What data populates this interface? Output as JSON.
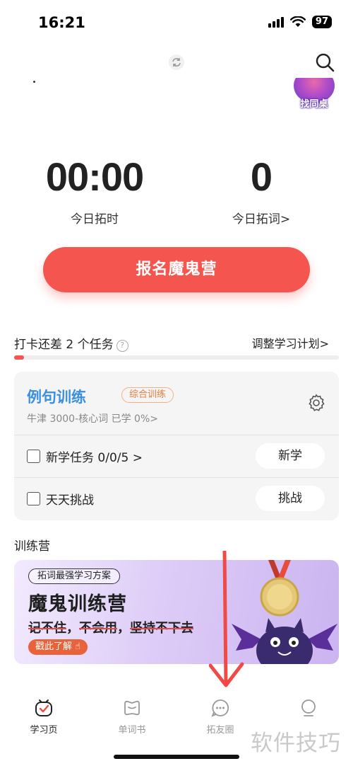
{
  "status_bar": {
    "time": "16:21",
    "battery": "97"
  },
  "header": {
    "find_desk_label": "找同桌"
  },
  "stats": [
    {
      "value": "00:00",
      "caption": "今日拓时"
    },
    {
      "value": "0",
      "caption": "今日拓词>"
    }
  ],
  "cta": {
    "label": "报名魔鬼营"
  },
  "checkin": {
    "text": "打卡还差 2 个任务",
    "help": "?",
    "adjust_link": "调整学习计划>",
    "progress_fraction": 0.03
  },
  "task_card": {
    "title": "例句训练",
    "tag": "综合训练",
    "subtitle": "牛津 3000-核心词  已学 0%>",
    "rows": [
      {
        "label": "新学任务 0/0/5 >",
        "button": "新学"
      },
      {
        "label": "天天挑战",
        "button": "挑战"
      }
    ]
  },
  "camp": {
    "section_title": "训练营",
    "banner": {
      "pill": "拓词最强学习方案",
      "title": "魔鬼训练营",
      "slogan_parts": [
        "记不住",
        "，",
        "不会用",
        "，",
        "坚持不下去"
      ],
      "button": "戳此了解"
    }
  },
  "tabbar": [
    {
      "label": "学习页",
      "icon": "study-page-icon",
      "active": true
    },
    {
      "label": "单词书",
      "icon": "word-book-icon",
      "active": false
    },
    {
      "label": "拓友圈",
      "icon": "friends-circle-icon",
      "active": false
    },
    {
      "label": "",
      "icon": "profile-icon",
      "active": false
    }
  ],
  "watermark": "软件技巧",
  "colors": {
    "accent": "#f4554e",
    "title_blue": "#3b8fe0",
    "tag_orange": "#e07c3e"
  }
}
